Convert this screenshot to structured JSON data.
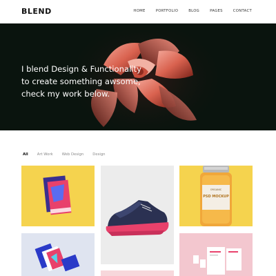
{
  "brand": {
    "logo": "BLEND"
  },
  "nav": {
    "items": [
      {
        "label": "HOME"
      },
      {
        "label": "PORTFOLIO"
      },
      {
        "label": "BLOG"
      },
      {
        "label": "PAGES"
      },
      {
        "label": "CONTACT"
      }
    ]
  },
  "hero": {
    "line1_prefix": "I blend ",
    "line1_highlight": "Design & Functionality",
    "line2": "to create something awsome,",
    "line3": "check my work below."
  },
  "filters": {
    "items": [
      {
        "label": "All",
        "active": true
      },
      {
        "label": "Art Work",
        "active": false
      },
      {
        "label": "Web Design",
        "active": false
      },
      {
        "label": "Design",
        "active": false
      }
    ]
  },
  "portfolio": {
    "items": [
      {
        "name": "brochure",
        "bg": "#f5d34e"
      },
      {
        "name": "sneaker",
        "bg": "#ececec"
      },
      {
        "name": "jar-mockup",
        "bg": "#f5d34e",
        "jar_label_top": "ORGANIC",
        "jar_label_main": "PSD MOCKUP"
      },
      {
        "name": "business-cards",
        "bg": "#dfe4f0"
      },
      {
        "name": "pink-item",
        "bg": "#f7d7db"
      },
      {
        "name": "stationery",
        "bg": "#f3c7cf"
      }
    ]
  },
  "colors": {
    "hero_bg": "#0a140e",
    "accent_yellow": "#f5d34e",
    "accent_pink": "#e8416b"
  }
}
